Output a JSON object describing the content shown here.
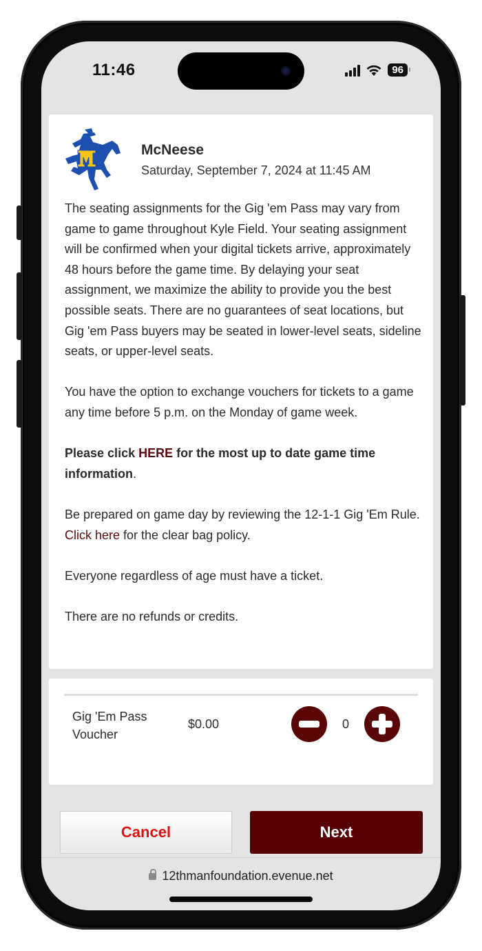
{
  "status_bar": {
    "time": "11:46",
    "battery": "96",
    "icons": [
      "cellular-signal-icon",
      "wifi-icon",
      "battery-icon"
    ]
  },
  "event": {
    "logo": "mcneese-cowboy-logo",
    "title": "McNeese",
    "datetime": "Saturday, September 7, 2024 at 11:45 AM"
  },
  "info": {
    "p1": "The seating assignments for the Gig 'em Pass may vary from game to game throughout Kyle Field. Your seating assignment will be confirmed when your digital tickets arrive, approximately 48 hours before the game time. By delaying your seat assignment, we maximize the ability to provide you the best possible seats. There are no guarantees of seat locations, but Gig 'em Pass buyers may be seated in lower-level seats, sideline seats, or upper-level seats.",
    "p2": "You have the option to exchange vouchers for tickets to a game any time before 5 p.m. on the Monday of game week.",
    "p3_before": "Please click ",
    "p3_link": "HERE",
    "p3_after": " for the most up to date game time information",
    "p3_end": ".",
    "p4_before": "Be prepared on game day by reviewing the 12-1-1 Gig 'Em Rule. ",
    "p4_link": "Click here",
    "p4_after": " for the clear bag policy.",
    "p5": "Everyone regardless of age must have a ticket.",
    "p6": "There are no refunds or credits."
  },
  "ticket": {
    "name": "Gig 'Em Pass Voucher",
    "price": "$0.00",
    "quantity": "0"
  },
  "actions": {
    "cancel": "Cancel",
    "next": "Next"
  },
  "browser": {
    "url": "12thmanfoundation.evenue.net"
  },
  "colors": {
    "brand_maroon": "#570005",
    "link_maroon": "#5a0a0a",
    "cancel_red": "#dd1111"
  }
}
